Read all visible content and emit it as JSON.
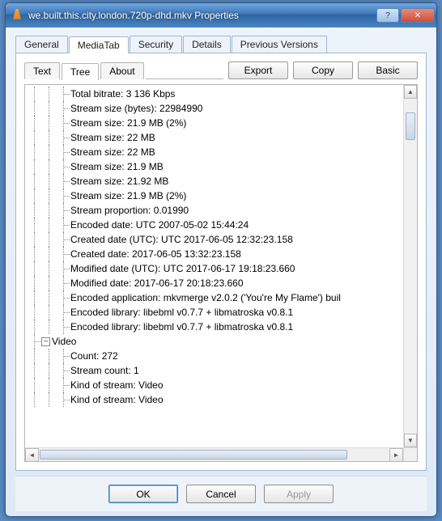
{
  "window": {
    "title": "we.built.this.city.london.720p-dhd.mkv Properties"
  },
  "outer_tabs": [
    "General",
    "MediaTab",
    "Security",
    "Details",
    "Previous Versions"
  ],
  "outer_active": 1,
  "inner_tabs": [
    "Text",
    "Tree",
    "About"
  ],
  "inner_active": 1,
  "buttons": {
    "export": "Export",
    "copy": "Copy",
    "basic": "Basic"
  },
  "dialog": {
    "ok": "OK",
    "cancel": "Cancel",
    "apply": "Apply"
  },
  "tree": {
    "items": [
      "Total bitrate: 3 136 Kbps",
      "Stream size (bytes): 22984990",
      "Stream size: 21.9 MB (2%)",
      "Stream size: 22 MB",
      "Stream size: 22 MB",
      "Stream size: 21.9 MB",
      "Stream size: 21.92 MB",
      "Stream size: 21.9 MB (2%)",
      "Stream proportion: 0.01990",
      "Encoded date: UTC 2007-05-02 15:44:24",
      "Created date (UTC): UTC 2017-06-05 12:32:23.158",
      "Created date: 2017-06-05 13:32:23.158",
      "Modified date (UTC): UTC 2017-06-17 19:18:23.660",
      "Modified date: 2017-06-17 20:18:23.660",
      "Encoded application: mkvmerge v2.0.2 ('You're My Flame') buil",
      "Encoded library: libebml v0.7.7 + libmatroska v0.8.1",
      "Encoded library: libebml v0.7.7 + libmatroska v0.8.1"
    ],
    "section": "Video",
    "section_items": [
      "Count: 272",
      "Stream count: 1",
      "Kind of stream: Video",
      "Kind of stream: Video"
    ]
  },
  "icons": {
    "minus": "−",
    "help": "?",
    "close": "✕",
    "up": "▲",
    "down": "▼",
    "left": "◄",
    "right": "►"
  }
}
